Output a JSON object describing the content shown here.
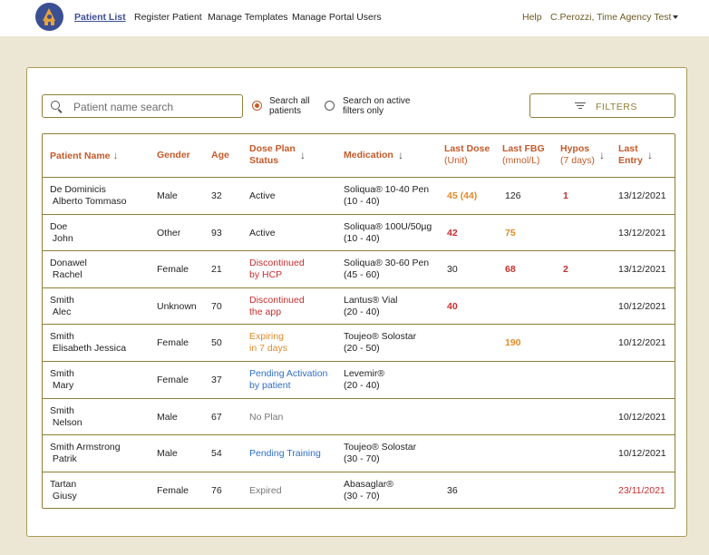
{
  "nav": {
    "patient_list": "Patient List",
    "register_patient": "Register Patient",
    "manage_templates": "Manage Templates",
    "manage_portal_users": "Manage Portal Users",
    "help": "Help",
    "user": "C.Perozzi, Time Agency Test"
  },
  "search": {
    "placeholder": "Patient name search"
  },
  "radios": {
    "all_line1": "Search all",
    "all_line2": "patients",
    "active_line1": "Search on active",
    "active_line2": "filters only"
  },
  "filters_label": "FILTERS",
  "colors": {
    "accent": "#c45a2a",
    "brand": "#3b4f93",
    "border": "#8f7e36",
    "red": "#c72e2e",
    "orange": "#e08b2a",
    "blue": "#2f6fc4"
  },
  "headers": {
    "name": "Patient Name",
    "gender": "Gender",
    "age": "Age",
    "dose_1": "Dose Plan",
    "dose_2": "Status",
    "medication": "Medication",
    "last_dose_1": "Last Dose",
    "last_dose_2": "(Unit)",
    "last_fbg_1": "Last FBG",
    "last_fbg_2": "(mmol/L)",
    "hypos_1": "Hypos",
    "hypos_2": "(7 days)",
    "last_entry_1": "Last",
    "last_entry_2": "Entry"
  },
  "rows": [
    {
      "last": "De Dominicis",
      "first": "Alberto Tommaso",
      "gender": "Male",
      "age": "32",
      "status1": "Active",
      "status2": "",
      "status_color": "normal",
      "med1": "Soliqua® 10-40 Pen",
      "med2": "(10 - 40)",
      "dose": "45 (44)",
      "dose_color": "orange",
      "fbg": "126",
      "fbg_color": "normal",
      "hypos": "1",
      "entry": "13/12/2021",
      "entry_color": "normal"
    },
    {
      "last": "Doe",
      "first": "John",
      "gender": "Other",
      "age": "93",
      "status1": "Active",
      "status2": "",
      "status_color": "normal",
      "med1": "Soliqua® 100U/50µg",
      "med2": "(10 - 40)",
      "dose": "42",
      "dose_color": "red",
      "fbg": "75",
      "fbg_color": "orange",
      "hypos": "",
      "entry": "13/12/2021",
      "entry_color": "normal"
    },
    {
      "last": "Donawel",
      "first": "Rachel",
      "gender": "Female",
      "age": "21",
      "status1": "Discontinued",
      "status2": "by HCP",
      "status_color": "red",
      "med1": "Soliqua® 30-60 Pen",
      "med2": "(45 - 60)",
      "dose": "30",
      "dose_color": "normal",
      "fbg": "68",
      "fbg_color": "red",
      "hypos": "2",
      "entry": "13/12/2021",
      "entry_color": "normal"
    },
    {
      "last": "Smith",
      "first": "Alec",
      "gender": "Unknown",
      "age": "70",
      "status1": "Discontinued",
      "status2": "the app",
      "status_color": "red",
      "med1": "Lantus® Vial",
      "med2": "(20 - 40)",
      "dose": "40",
      "dose_color": "red",
      "fbg": "",
      "fbg_color": "normal",
      "hypos": "",
      "entry": "10/12/2021",
      "entry_color": "normal"
    },
    {
      "last": "Smith",
      "first": "Elisabeth Jessica",
      "gender": "Female",
      "age": "50",
      "status1": "Expiring",
      "status2": "in 7 days",
      "status_color": "orange",
      "med1": "Toujeo® Solostar",
      "med2": "(20 - 50)",
      "dose": "",
      "dose_color": "normal",
      "fbg": "190",
      "fbg_color": "orange",
      "hypos": "",
      "entry": "10/12/2021",
      "entry_color": "normal"
    },
    {
      "last": "Smith",
      "first": "Mary",
      "gender": "Female",
      "age": "37",
      "status1": "Pending Activation",
      "status2": "by patient",
      "status_color": "blue",
      "med1": "Levemir®",
      "med2": "(20 - 40)",
      "dose": "",
      "dose_color": "normal",
      "fbg": "",
      "fbg_color": "normal",
      "hypos": "",
      "entry": "",
      "entry_color": "normal"
    },
    {
      "last": "Smith",
      "first": "Nelson",
      "gender": "Male",
      "age": "67",
      "status1": "No Plan",
      "status2": "",
      "status_color": "grey",
      "med1": "",
      "med2": "",
      "dose": "",
      "dose_color": "normal",
      "fbg": "",
      "fbg_color": "normal",
      "hypos": "",
      "entry": "10/12/2021",
      "entry_color": "normal"
    },
    {
      "last": "Smith Armstrong",
      "first": "Patrik",
      "gender": "Male",
      "age": "54",
      "status1": "Pending Training",
      "status2": "",
      "status_color": "blue",
      "med1": "Toujeo® Solostar",
      "med2": "(30 - 70)",
      "dose": "",
      "dose_color": "normal",
      "fbg": "",
      "fbg_color": "normal",
      "hypos": "",
      "entry": "10/12/2021",
      "entry_color": "normal"
    },
    {
      "last": "Tartan",
      "first": "Giusy",
      "gender": "Female",
      "age": "76",
      "status1": "Expired",
      "status2": "",
      "status_color": "grey",
      "med1": "Abasaglar®",
      "med2": "(30 - 70)",
      "dose": "36",
      "dose_color": "normal",
      "fbg": "",
      "fbg_color": "normal",
      "hypos": "",
      "entry": "23/11/2021",
      "entry_color": "red"
    }
  ]
}
